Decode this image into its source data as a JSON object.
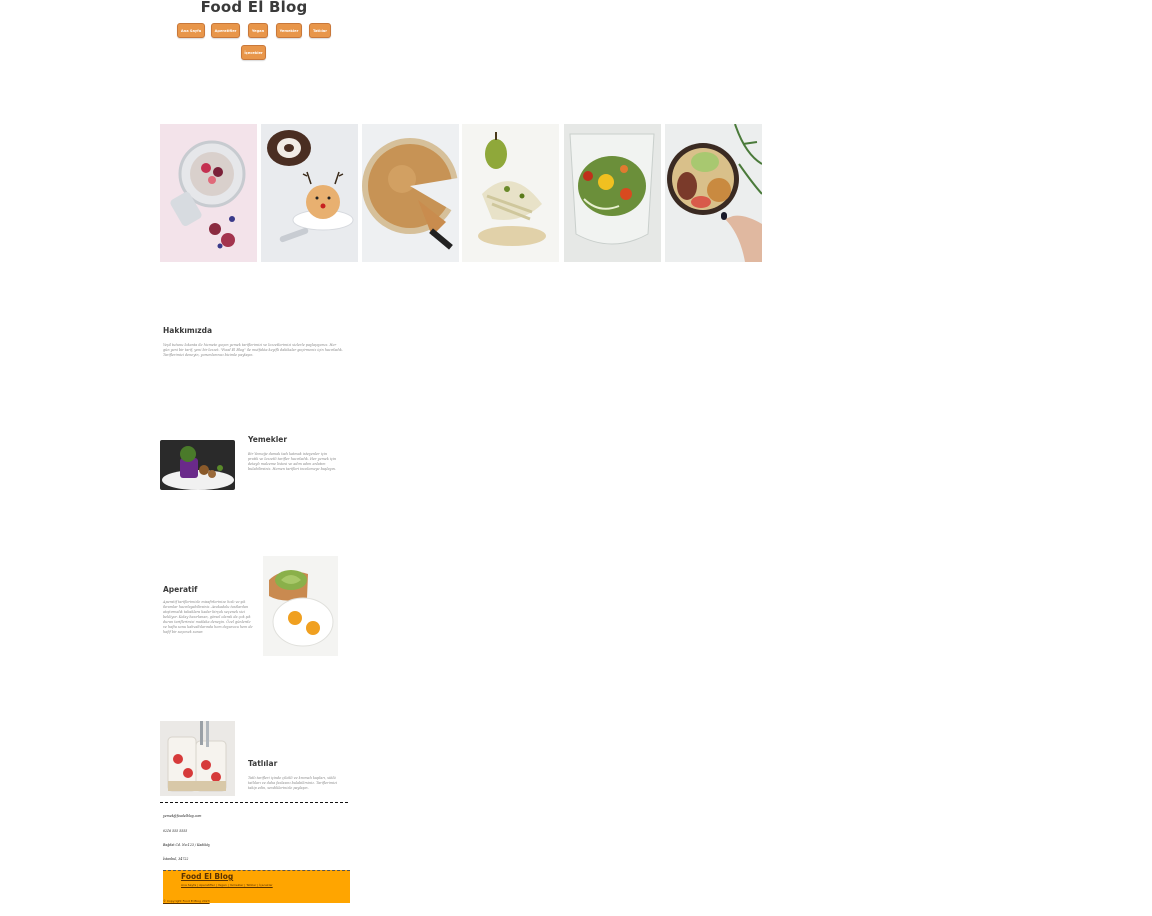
{
  "header": {
    "title": "Food El Blog"
  },
  "nav": {
    "items": [
      {
        "label": "Ana Sayfa"
      },
      {
        "label": "Aperatifler"
      },
      {
        "label": "Yegan"
      },
      {
        "label": "Yemekler"
      },
      {
        "label": "Tatlılar"
      },
      {
        "label": "İçecekler"
      }
    ]
  },
  "gallery": {
    "photos": [
      {
        "icon": "chia-pudding-jar-photo"
      },
      {
        "icon": "reindeer-dessert-photo"
      },
      {
        "icon": "pie-slice-photo"
      },
      {
        "icon": "pear-dish-photo"
      },
      {
        "icon": "salad-bowl-photo"
      },
      {
        "icon": "poke-bowl-photo"
      }
    ]
  },
  "about": {
    "title": "Hakkımızda",
    "text": "Yeşil tutunu lokanta ile hizmete geçen yemek tariflerimizi ve lezzetlerimizi sizlerle paylaşıyoruz. Her gün yeni bir tarif, yeni bir lezzet. \"Food El Blog\" ile mutfakta keyifli dakikalar geçirmeniz için hazırladık. Tariflerimizi deneyin, yorumlarınızı bizimle paylaşın."
  },
  "sections": {
    "yemekler": {
      "title": "Yemekler",
      "text": "Bir Yemeğe damak tadı katmak isteyenler için pratik ve lezzetli tarifler hazırladık. Her yemek için detaylı malzeme listesi ve adım adım anlatım bulabilirsiniz. Hemen tarifleri incelemeye başlayın.",
      "icon": "purple-dish-photo"
    },
    "aperatif": {
      "title": "Aperatif",
      "text": "Aperatif tariflerimizle misafirlerinize hızlı ve şık ikramlar hazırlayabilirsiniz. Avokadolu tostlardan atıştırmalık tabaklara kadar birçok seçenek sizi bekliyor. Kolay hazırlanan, görsel olarak da çok şık duran tariflerimizi mutlaka deneyin. Özel günlerde ve hafta sonu kahvaltılarında hem doyurucu hem de hafif bir seçenek sunar.",
      "icon": "avocado-toast-egg-photo"
    },
    "tatlilar": {
      "title": "Tatlılar",
      "text": "Tatlı tarifleri içinde çilekli ve kremalı kupları, sütlü tatlıları ve daha fazlasını bulabilirsiniz. Tariflerimizi takip edin, sevdiklerinizle paylaşın.",
      "icon": "strawberry-parfait-photo"
    }
  },
  "contact": {
    "email": "yemek@foodelblog.com",
    "phone": "0216 555 5555",
    "address": "Bağdat Cd. No:123 / Kadıköy",
    "city": "İstanbul, 34722"
  },
  "footer": {
    "brand": "Food El Blog",
    "links": "Ana Sayfa | Aperatifler | Yegan | Yemekler | Tatlılar | İçecekler",
    "copyright": "© Copyright Food El Blog 2023"
  },
  "colors": {
    "nav_button": "#e8964a",
    "footer_bar": "#ffa500",
    "title_text": "#3a3a3a"
  }
}
